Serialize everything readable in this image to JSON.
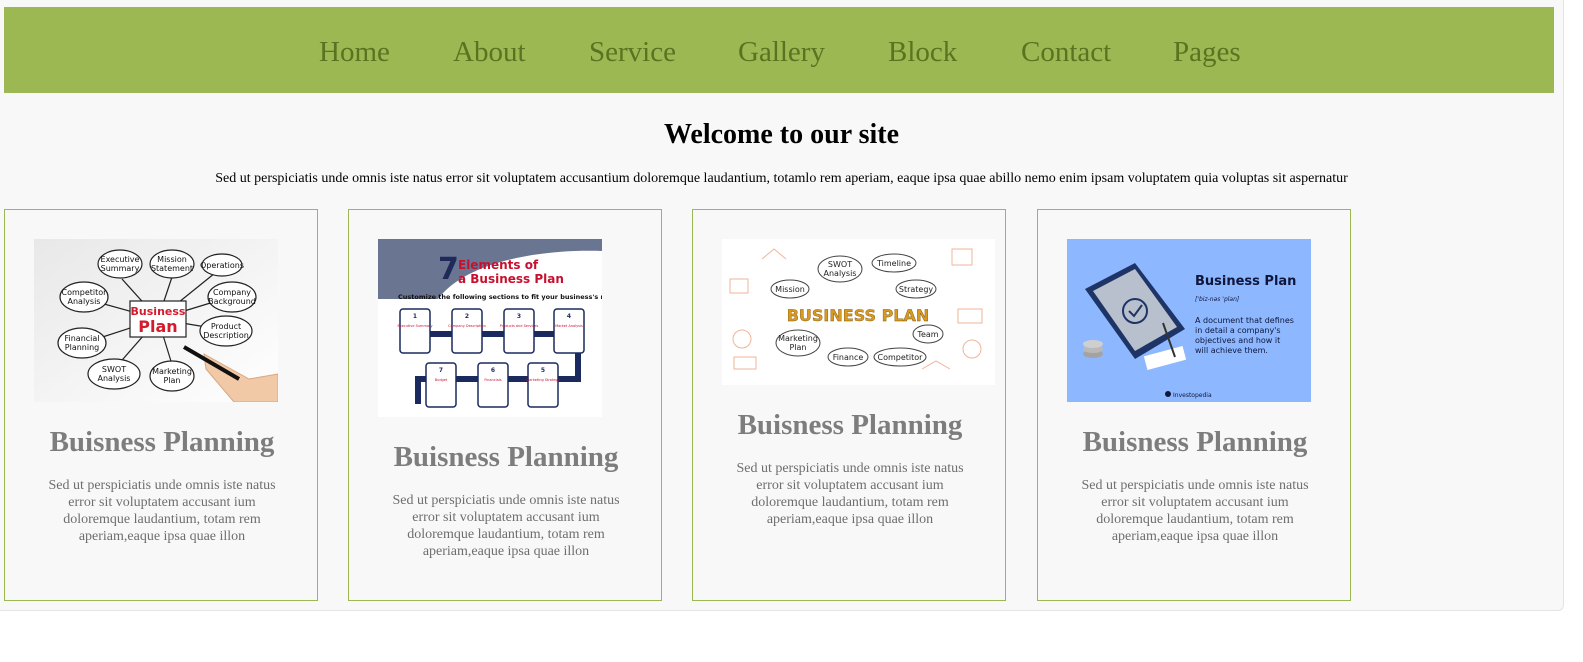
{
  "colors": {
    "nav_bg": "#9bb853",
    "nav_text": "#5b7320",
    "card_border": "#9bb853",
    "card_title": "#7d7d7d"
  },
  "nav": {
    "items": [
      {
        "label": "Home"
      },
      {
        "label": "About"
      },
      {
        "label": "Service"
      },
      {
        "label": "Gallery"
      },
      {
        "label": "Block"
      },
      {
        "label": "Contact"
      },
      {
        "label": "Pages"
      }
    ]
  },
  "hero": {
    "title": "Welcome to our site",
    "text": "Sed ut perspiciatis unde omnis iste natus error sit voluptatem accusantium doloremque laudantium, totamlo rem aperiam, eaque ipsa quae abillo nemo enim ipsam voluptatem quia voluptas sit aspernatur"
  },
  "cards": [
    {
      "title": "Buisness Planning",
      "text": "Sed ut perspiciatis unde omnis iste natus error sit voluptatem accusant ium doloremque laudantium, totam rem aperiam,eaque ipsa quae illon",
      "image": {
        "center": [
          "Business",
          "Plan"
        ],
        "bubbles": [
          "Executive Summary",
          "Mission Statement",
          "Operations",
          "Competitor Analysis",
          "Company Background",
          "Financial Planning",
          "Product Description",
          "SWOT Analysis",
          "Marketing Plan"
        ]
      }
    },
    {
      "title": "Buisness Planning",
      "text": "Sed ut perspiciatis unde omnis iste natus error sit voluptatem accusant ium doloremque laudantium, totam rem aperiam,eaque ipsa quae illon",
      "image": {
        "number": "7",
        "heading": [
          "Elements of",
          "a Business Plan"
        ],
        "sub": "Customize the following sections to fit your business's needs:",
        "steps": [
          "1",
          "2",
          "3",
          "4",
          "5",
          "6",
          "7"
        ],
        "step_labels": [
          "Executive Summary",
          "Company Description",
          "Products and Services",
          "Market Analysis",
          "Marketing Strategy",
          "Financials",
          "Budget"
        ]
      }
    },
    {
      "title": "Buisness Planning",
      "text": "Sed ut perspiciatis unde omnis iste natus error sit voluptatem accusant ium doloremque laudantium, totam rem aperiam,eaque ipsa quae illon",
      "image": {
        "center": "BUSINESS PLAN",
        "bubbles": [
          "SWOT Analysis",
          "Timeline",
          "Mission",
          "Strategy",
          "Team",
          "Marketing Plan",
          "Finance",
          "Competitor"
        ]
      }
    },
    {
      "title": "Buisness Planning",
      "text": "Sed ut perspiciatis unde omnis iste natus error sit voluptatem accusant ium doloremque laudantium, totam rem aperiam,eaque ipsa quae illon",
      "image": {
        "heading": "Business Plan",
        "pronunciation": "['biz-nəs 'plan]",
        "definition": [
          "A document that defines",
          "in detail a company's",
          "objectives and how it",
          "will achieve them."
        ],
        "brand": "Investopedia"
      }
    }
  ]
}
